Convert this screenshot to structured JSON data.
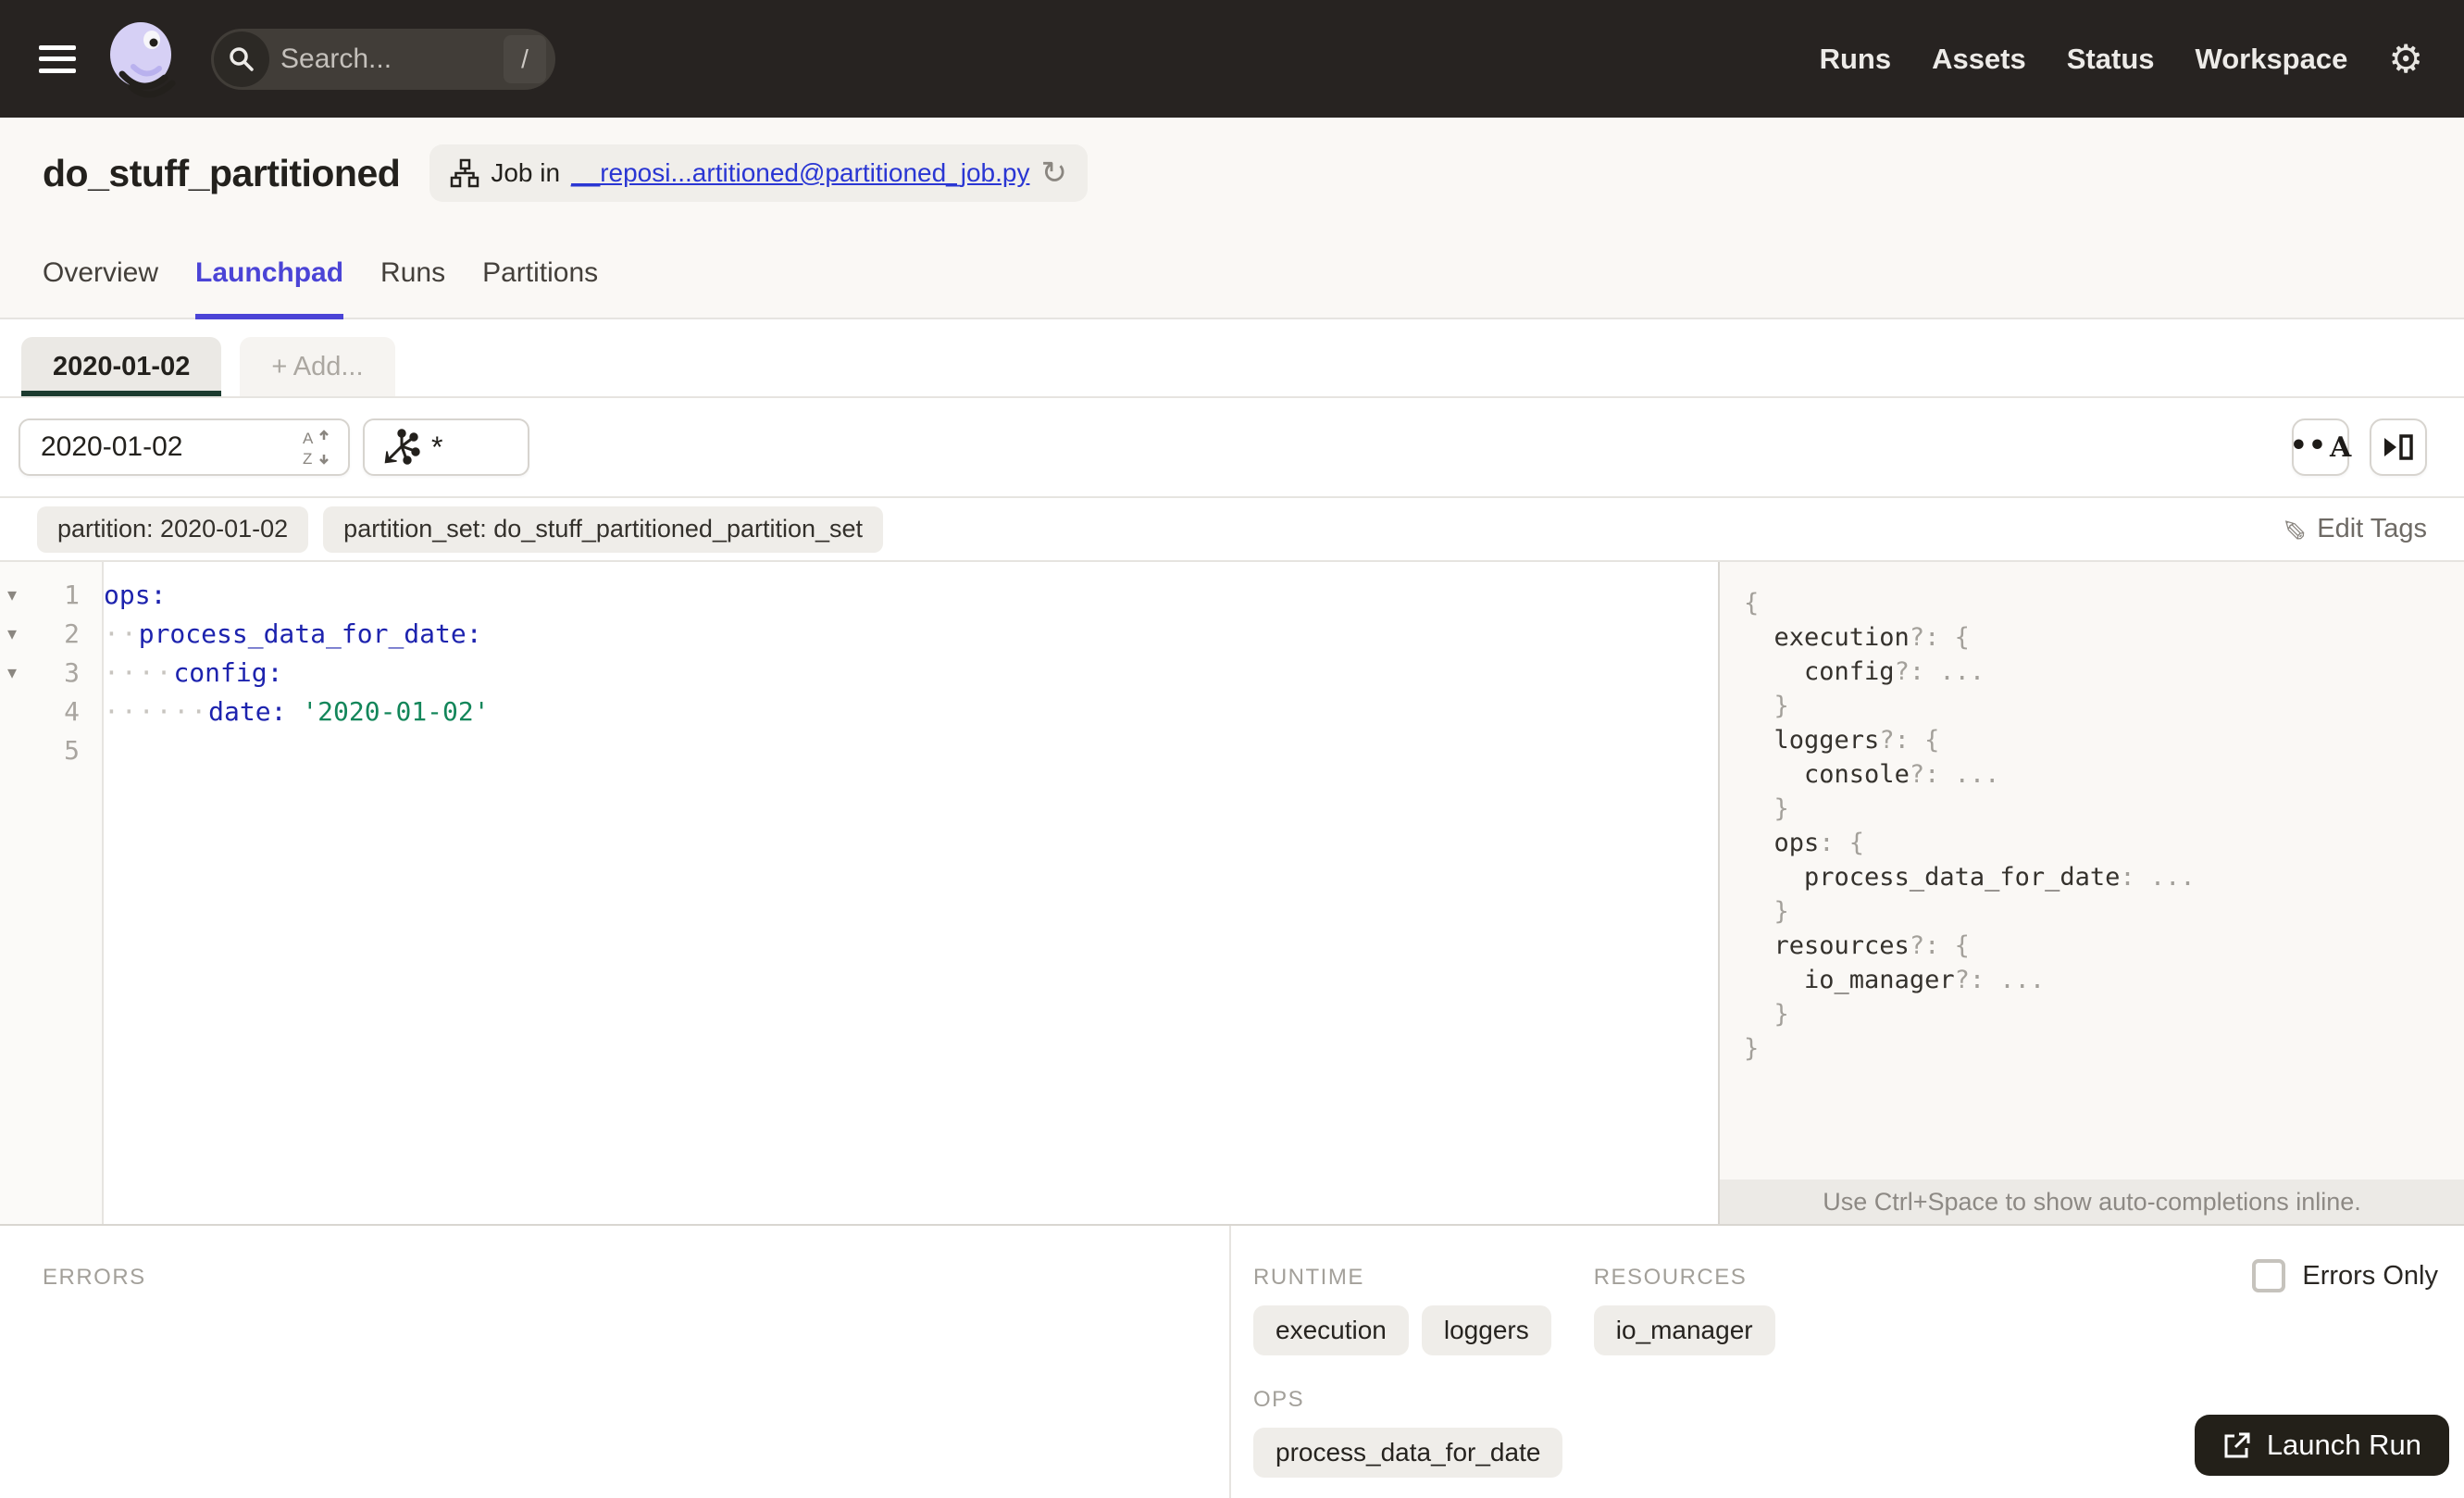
{
  "navbar": {
    "search_placeholder": "Search...",
    "search_shortcut": "/",
    "links": [
      "Runs",
      "Assets",
      "Status",
      "Workspace"
    ]
  },
  "header": {
    "title": "do_stuff_partitioned",
    "badge_prefix": "Job in",
    "badge_link": "__reposi...artitioned@partitioned_job.py"
  },
  "tabs": {
    "items": [
      {
        "label": "Overview",
        "active": false
      },
      {
        "label": "Launchpad",
        "active": true
      },
      {
        "label": "Runs",
        "active": false
      },
      {
        "label": "Partitions",
        "active": false
      }
    ]
  },
  "launchpad": {
    "config_tab": "2020-01-02",
    "add_tab_label": "+ Add...",
    "partition_value": "2020-01-02",
    "op_selector_value": "*",
    "tags": [
      "partition: 2020-01-02",
      "partition_set: do_stuff_partitioned_partition_set"
    ],
    "edit_tags_label": "Edit Tags"
  },
  "editor": {
    "lines": [
      {
        "num": "1",
        "fold": true,
        "segments": [
          {
            "t": "ops:",
            "c": "key"
          }
        ]
      },
      {
        "num": "2",
        "fold": true,
        "segments": [
          {
            "t": "··",
            "c": "ws"
          },
          {
            "t": "process_data_for_date:",
            "c": "key"
          }
        ]
      },
      {
        "num": "3",
        "fold": true,
        "segments": [
          {
            "t": "····",
            "c": "ws"
          },
          {
            "t": "config:",
            "c": "key"
          }
        ]
      },
      {
        "num": "4",
        "fold": false,
        "segments": [
          {
            "t": "······",
            "c": "ws"
          },
          {
            "t": "date:",
            "c": "key"
          },
          {
            "t": " ",
            "c": "plain"
          },
          {
            "t": "'2020-01-02'",
            "c": "str"
          }
        ]
      },
      {
        "num": "5",
        "fold": false,
        "segments": []
      }
    ]
  },
  "schema": {
    "lines": [
      [
        {
          "t": "{",
          "c": "p"
        }
      ],
      [
        {
          "t": "  ",
          "c": "p"
        },
        {
          "t": "execution",
          "c": "k"
        },
        {
          "t": "?: {",
          "c": "p"
        }
      ],
      [
        {
          "t": "    ",
          "c": "p"
        },
        {
          "t": "config",
          "c": "k"
        },
        {
          "t": "?: ...",
          "c": "p"
        }
      ],
      [
        {
          "t": "  }",
          "c": "p"
        }
      ],
      [
        {
          "t": "  ",
          "c": "p"
        },
        {
          "t": "loggers",
          "c": "k"
        },
        {
          "t": "?: {",
          "c": "p"
        }
      ],
      [
        {
          "t": "    ",
          "c": "p"
        },
        {
          "t": "console",
          "c": "k"
        },
        {
          "t": "?: ...",
          "c": "p"
        }
      ],
      [
        {
          "t": "  }",
          "c": "p"
        }
      ],
      [
        {
          "t": "  ",
          "c": "p"
        },
        {
          "t": "ops",
          "c": "k"
        },
        {
          "t": ": {",
          "c": "p"
        }
      ],
      [
        {
          "t": "    ",
          "c": "p"
        },
        {
          "t": "process_data_for_date",
          "c": "k"
        },
        {
          "t": ": ...",
          "c": "p"
        }
      ],
      [
        {
          "t": "  }",
          "c": "p"
        }
      ],
      [
        {
          "t": "  ",
          "c": "p"
        },
        {
          "t": "resources",
          "c": "k"
        },
        {
          "t": "?: {",
          "c": "p"
        }
      ],
      [
        {
          "t": "    ",
          "c": "p"
        },
        {
          "t": "io_manager",
          "c": "k"
        },
        {
          "t": "?: ...",
          "c": "p"
        }
      ],
      [
        {
          "t": "  }",
          "c": "p"
        }
      ],
      [
        {
          "t": "}",
          "c": "p"
        }
      ]
    ],
    "hint": "Use Ctrl+Space to show auto-completions inline."
  },
  "bottom": {
    "errors_label": "ERRORS",
    "sections": [
      {
        "label": "RUNTIME",
        "chips": [
          "execution",
          "loggers"
        ]
      },
      {
        "label": "RESOURCES",
        "chips": [
          "io_manager"
        ]
      },
      {
        "label": "OPS",
        "chips": [
          "process_data_for_date"
        ]
      }
    ],
    "errors_only_label": "Errors Only",
    "launch_label": "Launch Run"
  },
  "icons": {
    "gear": "⚙",
    "refresh": "↻",
    "pencil": "✎",
    "fold": "▾",
    "dots_a": "••",
    "dots_a_letter": "A"
  },
  "colors": {
    "navbar-bg": "#272321",
    "accent": "#4B44D6",
    "link-blue": "#2A36D3",
    "partition-underline": "#1C3B2F",
    "key-navy": "#1D23AE",
    "string-green": "#13865A",
    "launch-bg": "#232019",
    "chip-bg": "#EFEDE9",
    "page-bg": "#FAF8F5"
  }
}
